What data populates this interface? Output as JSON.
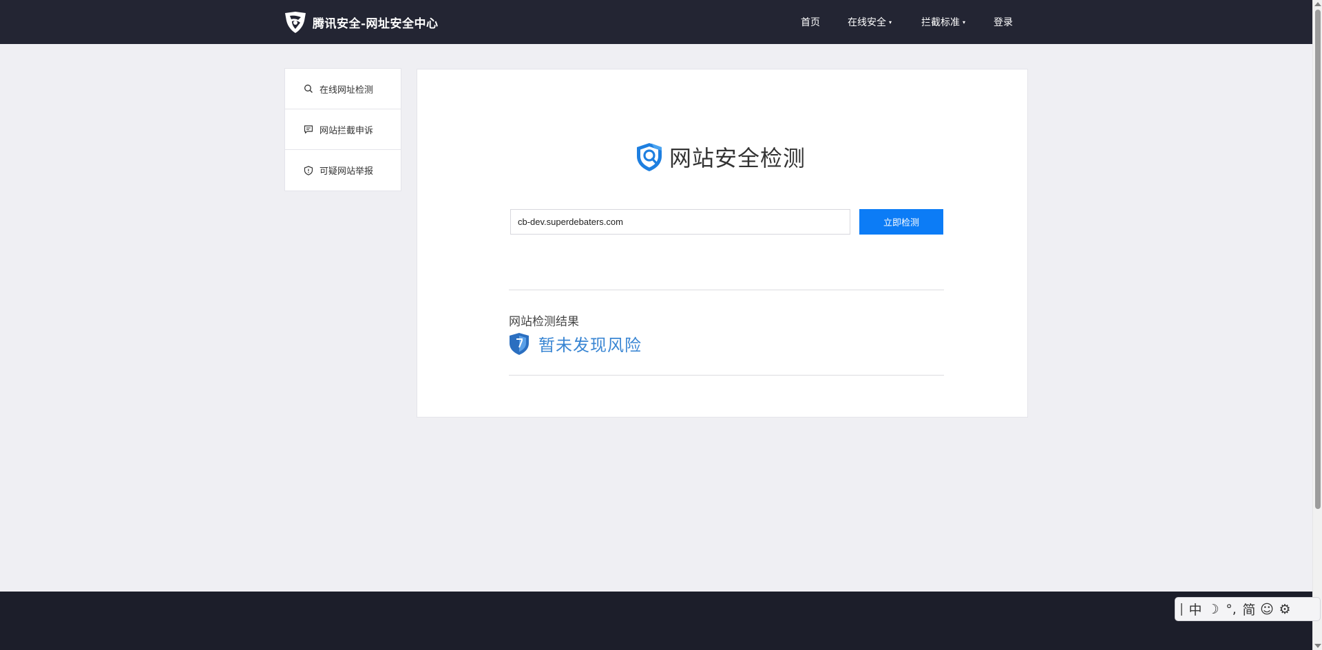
{
  "header": {
    "brand_title": "腾讯安全-网址安全中心",
    "nav": [
      {
        "label": "首页",
        "has_caret": false
      },
      {
        "label": "在线安全",
        "has_caret": true
      },
      {
        "label": "拦截标准",
        "has_caret": true
      },
      {
        "label": "登录",
        "has_caret": false
      }
    ],
    "caret_glyph": "▾"
  },
  "sidebar": {
    "items": [
      {
        "label": "在线网址检测",
        "icon": "search-icon"
      },
      {
        "label": "网站拦截申诉",
        "icon": "message-icon"
      },
      {
        "label": "可疑网站举报",
        "icon": "shield-icon"
      }
    ]
  },
  "main": {
    "title": "网站安全检测",
    "url_value": "cb-dev.superdebaters.com",
    "check_button": "立即检测",
    "result_label": "网站检测结果",
    "result_text": "暂未发现风险"
  },
  "ime": {
    "items": [
      "中",
      "☽",
      "°,",
      "简",
      "☺",
      "⚙"
    ]
  },
  "colors": {
    "header_bg": "#232533",
    "page_bg": "#efeff3",
    "accent": "#0c7cf6",
    "result_text": "#3a86d3",
    "footer_bg": "#1c1e2a"
  }
}
